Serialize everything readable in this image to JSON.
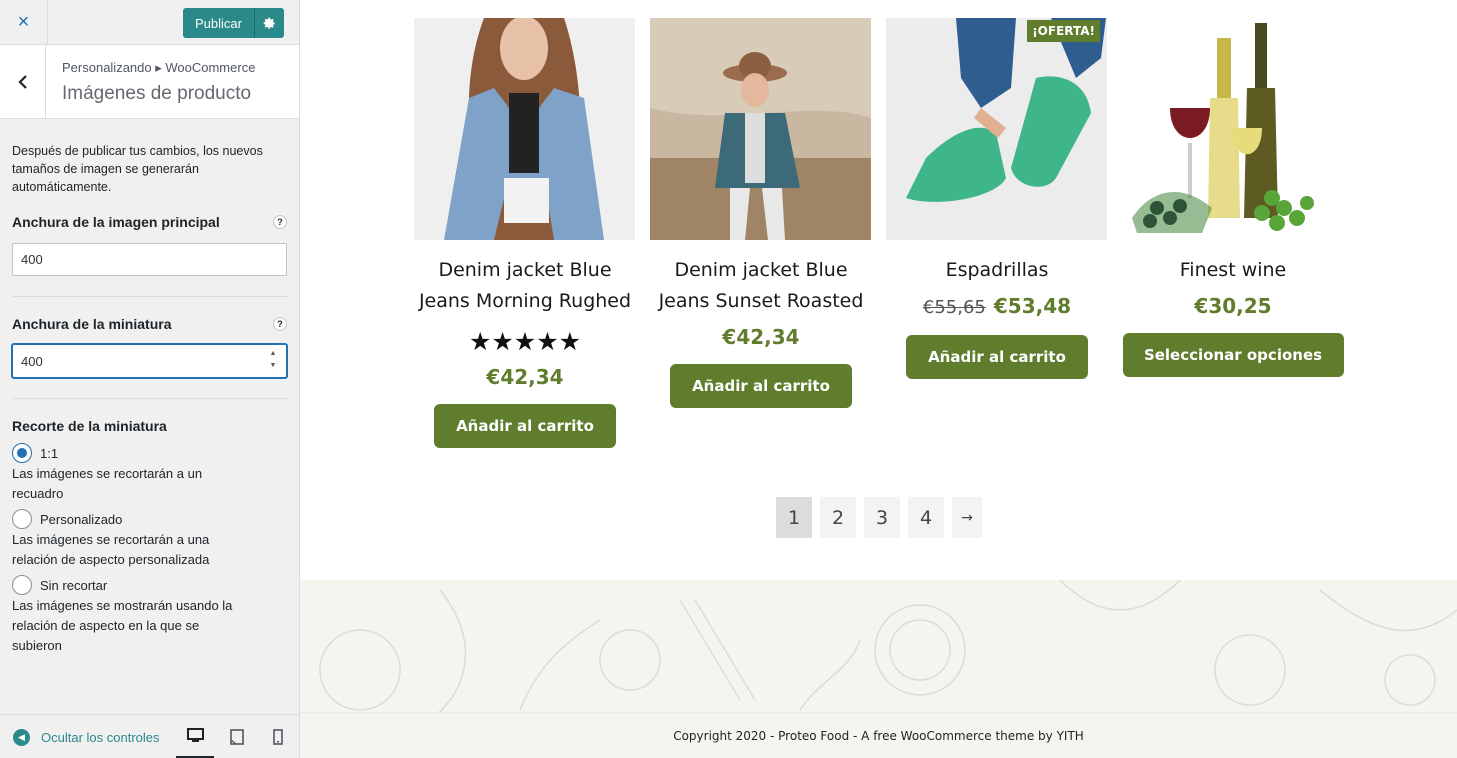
{
  "sidebar": {
    "close_glyph": "×",
    "publish_label": "Publicar",
    "breadcrumb": "Personalizando ▸ WooCommerce",
    "section_title": "Imágenes de producto",
    "description": "Después de publicar tus cambios, los nuevos tamaños de imagen se generarán automáticamente.",
    "main_width": {
      "label": "Anchura de la imagen principal",
      "value": "400",
      "help": "?"
    },
    "thumb_width": {
      "label": "Anchura de la miniatura",
      "value": "400",
      "help": "?"
    },
    "crop": {
      "label": "Recorte de la miniatura",
      "options": [
        {
          "label": "1:1",
          "desc": "Las imágenes se recortarán a un recuadro",
          "checked": true
        },
        {
          "label": "Personalizado",
          "desc": "Las imágenes se recortarán a una relación de aspecto personalizada",
          "checked": false
        },
        {
          "label": "Sin recortar",
          "desc": "Las imágenes se mostrarán usando la relación de aspecto en la que se subieron",
          "checked": false
        }
      ]
    },
    "hide_controls": "Ocultar los controles"
  },
  "products": [
    {
      "name": "Denim jacket Blue Jeans Morning Rughed",
      "rating": "★★★★★",
      "price": "€42,34",
      "button": "Añadir al carrito"
    },
    {
      "name": "Denim jacket Blue Jeans Sunset Roasted",
      "price": "€42,34",
      "button": "Añadir al carrito"
    },
    {
      "name": "Espadrillas",
      "old_price": "€55,65",
      "price": "€53,48",
      "button": "Añadir al carrito",
      "badge": "¡OFERTA!"
    },
    {
      "name": "Finest wine",
      "price": "€30,25",
      "button": "Seleccionar opciones"
    }
  ],
  "pagination": [
    "1",
    "2",
    "3",
    "4",
    "→"
  ],
  "footer": "Copyright 2020 - Proteo Food - A free WooCommerce theme by YITH",
  "colors": {
    "accent": "#2a8a8a",
    "wp_blue": "#2271b1",
    "shop_green": "#5f7d2c"
  }
}
